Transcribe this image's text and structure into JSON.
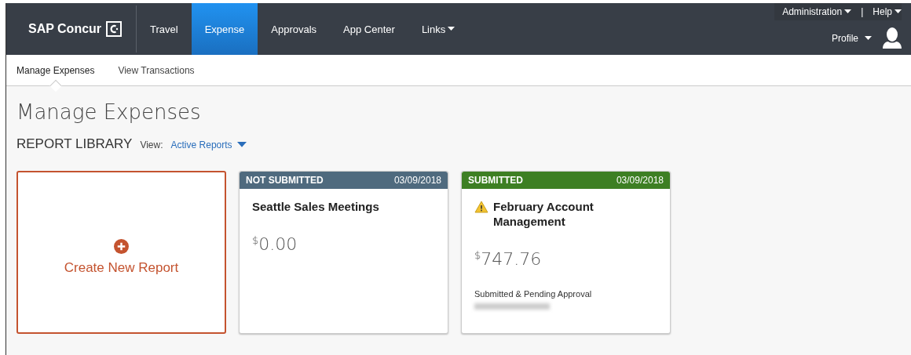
{
  "header": {
    "logo": "SAP Concur",
    "nav": [
      {
        "label": "Travel",
        "selected": false,
        "dropdown": false
      },
      {
        "label": "Expense",
        "selected": true,
        "dropdown": false
      },
      {
        "label": "Approvals",
        "selected": false,
        "dropdown": false
      },
      {
        "label": "App Center",
        "selected": false,
        "dropdown": false
      },
      {
        "label": "Links",
        "selected": false,
        "dropdown": true
      }
    ],
    "utility_links": [
      "Administration",
      "Help"
    ],
    "separator": "|",
    "profile": "Profile"
  },
  "subnav": [
    {
      "label": "Manage Expenses",
      "selected": true
    },
    {
      "label": "View Transactions",
      "selected": false
    }
  ],
  "page_title": "Manage Expenses",
  "library": {
    "title": "REPORT LIBRARY",
    "view_label": "View:",
    "view_value": "Active Reports"
  },
  "create_card": {
    "label": "Create New Report"
  },
  "reports": [
    {
      "status": "NOT SUBMITTED",
      "color": "#4f6a7e",
      "date": "03/09/2018",
      "title": "Seattle Sales Meetings",
      "warning": false,
      "currency": "$",
      "amount": "0.00"
    },
    {
      "status": "SUBMITTED",
      "color": "#3d7f23",
      "date": "03/09/2018",
      "title": "February Account Management",
      "warning": true,
      "currency": "$",
      "amount": "747.76",
      "note": "Submitted & Pending Approval",
      "redacted_name": true
    }
  ]
}
